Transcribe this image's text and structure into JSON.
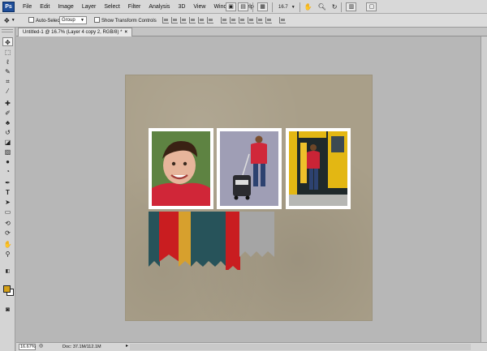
{
  "app": {
    "logo": "Ps"
  },
  "menubar": {
    "items": [
      "File",
      "Edit",
      "Image",
      "Layer",
      "Select",
      "Filter",
      "Analysis",
      "3D",
      "View",
      "Window",
      "Help"
    ],
    "zoom": "16.7"
  },
  "options": {
    "auto_select_label": "Auto-Select:",
    "auto_select_value": "Group",
    "transform_label": "Show Transform Controls"
  },
  "document": {
    "tab_title": "Untitled-1 @ 16.7% (Layer 4 copy 2, RGB/8) *",
    "close": "×"
  },
  "statusbar": {
    "zoom": "16.67%",
    "doc_size": "Doc: 37.1M/112.1M"
  },
  "colors": {
    "foreground": "#d4a018",
    "background": "#ffffff",
    "paper": "#a99f89",
    "banner_teal": "#27535a",
    "banner_red": "#c91d20",
    "banner_gold": "#d7a02d",
    "banner_gray": "#a5a5a5"
  },
  "tools": [
    "move-tool",
    "marquee-tool",
    "lasso-tool",
    "quick-select-tool",
    "crop-tool",
    "eyedropper-tool",
    "healing-tool",
    "brush-tool",
    "clone-stamp-tool",
    "history-brush-tool",
    "eraser-tool",
    "gradient-tool",
    "blur-tool",
    "dodge-tool",
    "pen-tool",
    "type-tool",
    "path-select-tool",
    "shape-tool",
    "3d-rotate-tool",
    "3d-orbit-tool",
    "hand-tool",
    "zoom-tool"
  ]
}
